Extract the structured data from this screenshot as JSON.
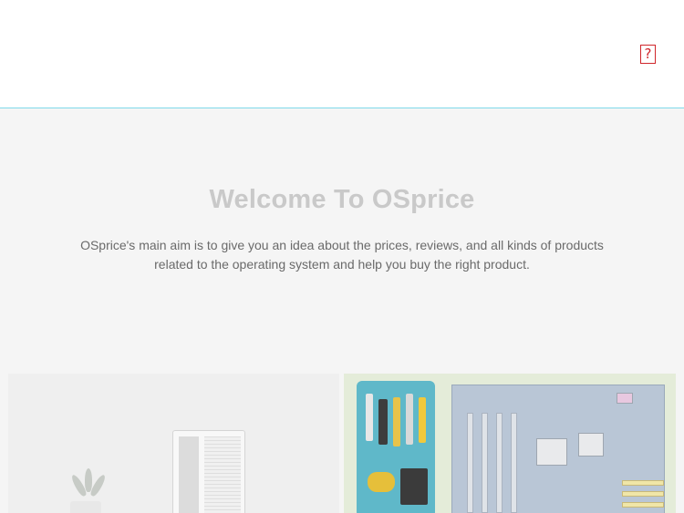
{
  "header": {
    "menu_icon_glyph": "?"
  },
  "intro": {
    "title": "Welcome To OSprice",
    "description": "OSprice's main aim is to give you an idea about the prices, reviews, and all kinds of products related to the operating system and help you buy the right product."
  },
  "cards": [
    {
      "image": "desktop-pc-with-plant"
    },
    {
      "image": "toolkit-and-motherboard"
    }
  ],
  "colors": {
    "header_border": "#7fd9ea",
    "icon_red": "#d0262b",
    "title": "#c9c9c9",
    "text": "#6a6a6a",
    "background": "#f5f5f5"
  }
}
